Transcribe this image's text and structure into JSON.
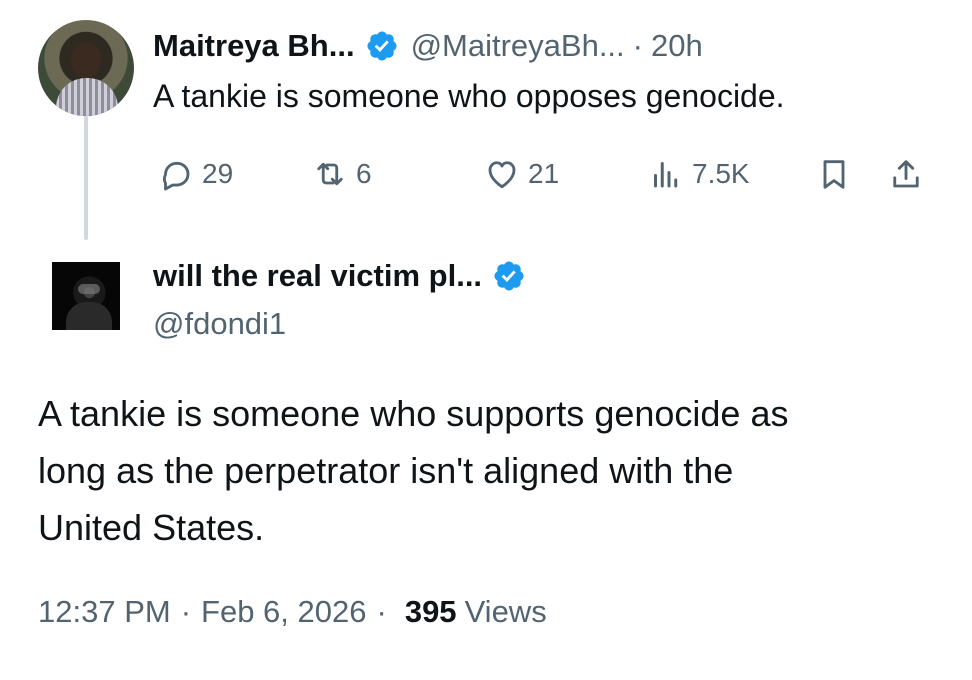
{
  "parent_tweet": {
    "name": "Maitreya Bh...",
    "handle": "@MaitreyaBh...",
    "separator": "·",
    "time": "20h",
    "text": "A tankie is someone who opposes genocide.",
    "actions": {
      "replies": "29",
      "retweets": "6",
      "likes": "21",
      "views": "7.5K"
    },
    "icons": [
      "reply-icon",
      "retweet-icon",
      "like-icon",
      "views-icon",
      "bookmark-icon",
      "share-icon"
    ]
  },
  "main_tweet": {
    "name": "will the real victim pl...",
    "handle": "@fdondi1",
    "text": "A tankie is someone who supports genocide as\nlong as the perpetrator isn't aligned with the\nUnited States.",
    "meta": {
      "time": "12:37 PM",
      "separator": "·",
      "date": "Feb 6, 2026",
      "views_count": "395",
      "views_label": "Views"
    }
  },
  "colors": {
    "verified": "#1d9bf0",
    "secondary_text": "#536471",
    "primary_text": "#0f1419",
    "thread_line": "#cfd9de"
  }
}
